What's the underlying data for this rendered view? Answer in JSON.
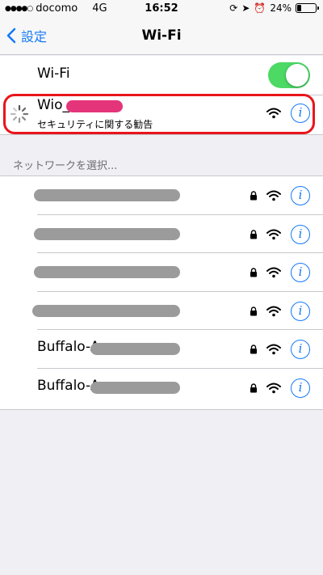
{
  "statusbar": {
    "carrier": "docomo",
    "network": "4G",
    "time": "16:52",
    "battery": "24%",
    "battery_level": 0.24
  },
  "nav": {
    "back_label": "設定",
    "title": "Wi-Fi"
  },
  "wifi_toggle": {
    "label": "Wi-Fi",
    "on": true
  },
  "connecting": {
    "name": "Wio_",
    "subtitle": "セキュリティに関する勧告"
  },
  "section_header": "ネットワークを選択...",
  "networks": [
    {
      "name": "",
      "locked": true
    },
    {
      "name": "",
      "locked": true
    },
    {
      "name": "",
      "locked": true
    },
    {
      "name": "",
      "locked": true
    },
    {
      "name": "Buffalo-A",
      "locked": true
    },
    {
      "name": "Buffalo-A",
      "locked": true
    }
  ],
  "colors": {
    "accent": "#1379f6",
    "toggle_on": "#4cd964",
    "highlight": "#e8151b",
    "redact_pink": "#e4347a",
    "redact_gray": "#9b9b9b"
  }
}
